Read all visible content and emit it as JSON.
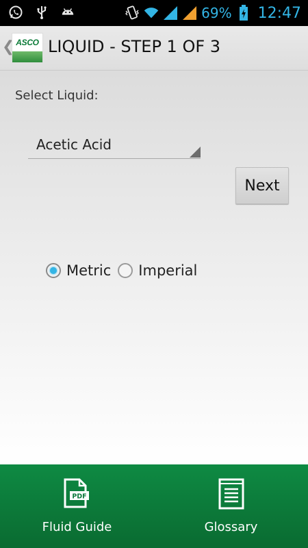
{
  "status_bar": {
    "battery_percent": "69%",
    "time": "12:47",
    "icons": [
      "whatsapp-icon",
      "usb-icon",
      "android-icon",
      "vibrate-icon",
      "wifi-icon",
      "signal-icon",
      "signal-icon",
      "battery-charging-icon"
    ]
  },
  "action_bar": {
    "logo_text": "ASCO",
    "title": "LIQUID - STEP 1 OF 3"
  },
  "form": {
    "select_label": "Select Liquid:",
    "selected_liquid": "Acetic Acid",
    "next_label": "Next",
    "units": [
      {
        "label": "Metric",
        "checked": true
      },
      {
        "label": "Imperial",
        "checked": false
      }
    ]
  },
  "bottom_nav": {
    "fluid_guide_label": "Fluid Guide",
    "pdf_icon_text": "PDF",
    "glossary_label": "Glossary"
  },
  "colors": {
    "accent": "#33b5e5",
    "bottom_bar": "#0e8a43",
    "brand_green": "#0a7a37"
  }
}
